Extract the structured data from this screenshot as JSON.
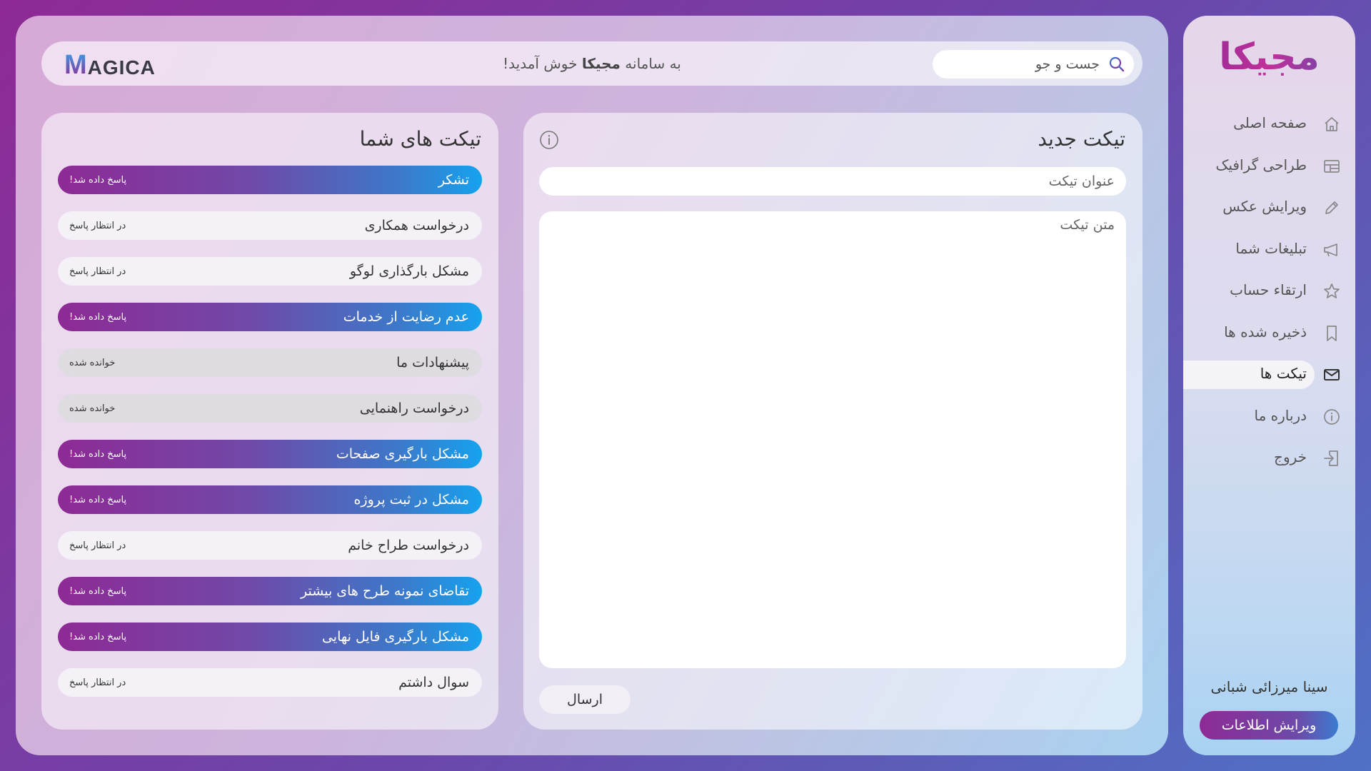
{
  "topbar": {
    "logo_text": "MAGICA",
    "welcome_prefix": "به سامانه ",
    "welcome_brand": "مجیکا",
    "welcome_suffix": " خوش آمدید!",
    "search_placeholder": "جست و جو"
  },
  "new_ticket": {
    "title": "تیکت جدید",
    "subject_placeholder": "عنوان تیکت",
    "body_placeholder": "متن تیکت",
    "send_label": "ارسال"
  },
  "tickets": {
    "title": "تیکت های شما",
    "items": [
      {
        "name": "تشکر",
        "status": "پاسخ داده شد!",
        "state": "answered"
      },
      {
        "name": "درخواست همکاری",
        "status": "در انتظار پاسخ",
        "state": "waiting"
      },
      {
        "name": "مشکل بارگذاری لوگو",
        "status": "در انتظار پاسخ",
        "state": "waiting"
      },
      {
        "name": "عدم رضایت از خدمات",
        "status": "پاسخ داده شد!",
        "state": "answered"
      },
      {
        "name": "پیشنهادات ما",
        "status": "خوانده شده",
        "state": "read"
      },
      {
        "name": "درخواست راهنمایی",
        "status": "خوانده شده",
        "state": "read"
      },
      {
        "name": "مشکل بارگیری صفحات",
        "status": "پاسخ داده شد!",
        "state": "answered"
      },
      {
        "name": "مشکل در ثبت پروژه",
        "status": "پاسخ داده شد!",
        "state": "answered"
      },
      {
        "name": "درخواست طراح خانم",
        "status": "در انتظار پاسخ",
        "state": "waiting"
      },
      {
        "name": "تقاضای نمونه طرح های بیشتر",
        "status": "پاسخ داده شد!",
        "state": "answered"
      },
      {
        "name": "مشکل بارگیری فایل نهایی",
        "status": "پاسخ داده شد!",
        "state": "answered"
      },
      {
        "name": "سوال داشتم",
        "status": "در انتظار پاسخ",
        "state": "waiting"
      }
    ]
  },
  "sidebar": {
    "logo_text": "مجیکا",
    "items": [
      {
        "label": "صفحه اصلی",
        "icon": "home-icon"
      },
      {
        "label": "طراحی گرافیک",
        "icon": "layout-icon"
      },
      {
        "label": "ویرایش عکس",
        "icon": "pencil-icon"
      },
      {
        "label": "تبلیغات شما",
        "icon": "megaphone-icon"
      },
      {
        "label": "ارتقاء حساب",
        "icon": "star-icon"
      },
      {
        "label": "ذخیره شده ها",
        "icon": "bookmark-icon"
      },
      {
        "label": "تیکت ها",
        "icon": "envelope-icon",
        "active": true
      },
      {
        "label": "درباره ما",
        "icon": "info-icon"
      },
      {
        "label": "خروج",
        "icon": "logout-icon"
      }
    ],
    "user_name": "سینا میرزائی شبانی",
    "edit_label": "ویرایش اطلاعات"
  },
  "colors": {
    "accent_purple": "#8e2a95",
    "accent_blue": "#15a2ee",
    "ticket_waiting_bg": "#f4f2f6",
    "ticket_read_bg": "#dedbe1"
  }
}
